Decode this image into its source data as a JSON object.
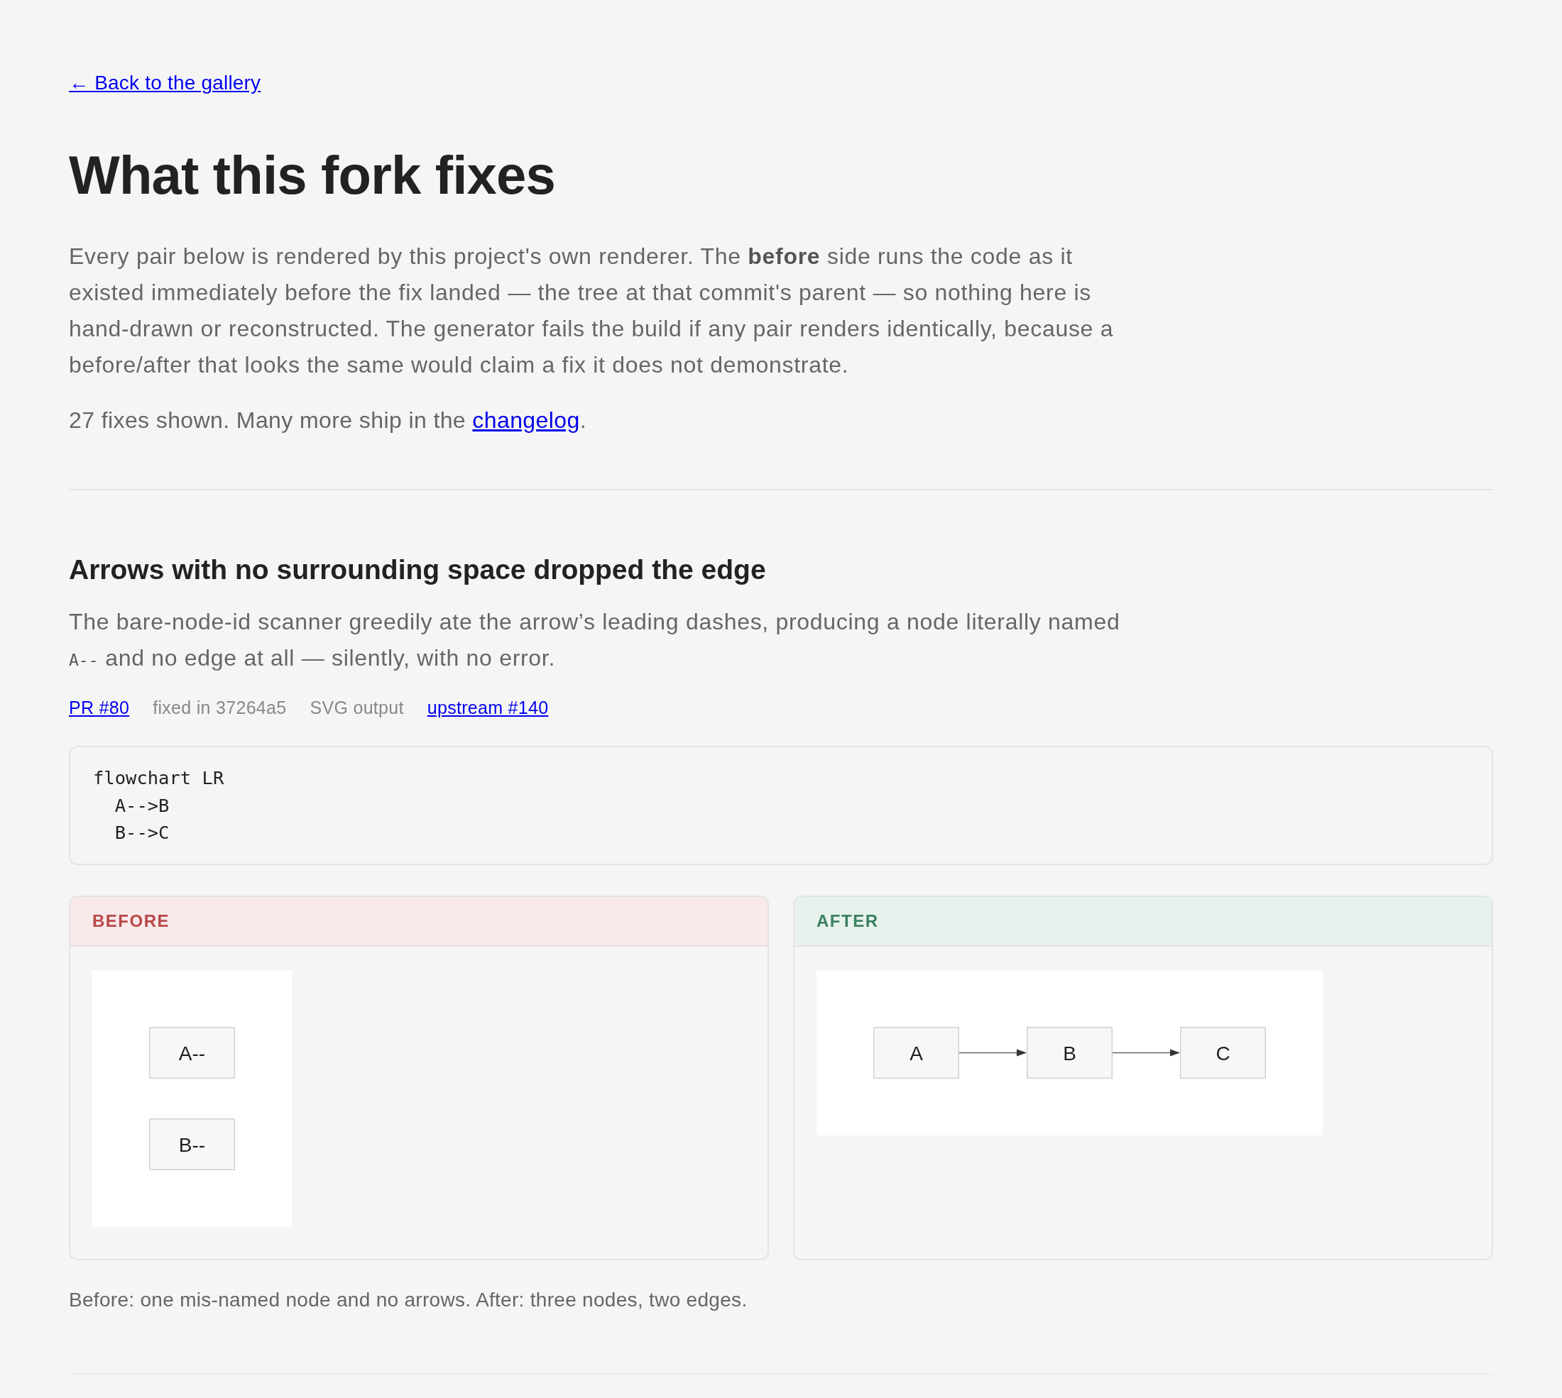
{
  "back_link": {
    "text": "← Back to the gallery"
  },
  "title": "What this fork fixes",
  "intro": "Every pair below is rendered by this project's own renderer. The **before** side runs the code as it existed immediately before the fix landed — the tree at that commit's parent — so nothing here is hand-drawn or reconstructed. The generator fails the build if any pair renders identically, because a before/after that looks the same would claim a fix it does not demonstrate.",
  "summary": {
    "text": "27 fixes shown. Many more ship in the ",
    "link": "changelog",
    "end": "."
  },
  "fixes": [
    {
      "title": "Arrows with no surrounding space dropped the edge",
      "description": [
        {
          "kind": "text",
          "text": "The bare-node-id scanner greedily ate the arrow’s leading dashes, producing a node literally named "
        },
        {
          "kind": "code",
          "text": "A--"
        },
        {
          "kind": "text",
          "text": " and no edge at all — silently, with no error."
        }
      ],
      "meta": [
        {
          "kind": "link",
          "text": "PR #80"
        },
        {
          "kind": "text",
          "text": "fixed in 37264a5"
        },
        {
          "kind": "text",
          "text": "SVG output"
        },
        {
          "kind": "link",
          "text": "upstream #140"
        }
      ],
      "code": [
        "flowchart LR",
        "  A-->B",
        "  B-->C"
      ],
      "panels": [
        {
          "kind": "before",
          "label": "BEFORE",
          "diagram": {
            "kind": "column",
            "nodes": [
              {
                "label": "A--",
                "edge_to_next": false
              },
              {
                "label": "B--"
              }
            ]
          }
        },
        {
          "kind": "after",
          "label": "AFTER",
          "diagram": {
            "kind": "row",
            "nodes": [
              {
                "label": "A",
                "edge_to_next": true
              },
              {
                "label": "B",
                "edge_to_next": true
              },
              {
                "label": "C"
              }
            ]
          }
        }
      ],
      "caption": "Before: one mis-named node and no arrows. After: three nodes, two edges."
    }
  ]
}
